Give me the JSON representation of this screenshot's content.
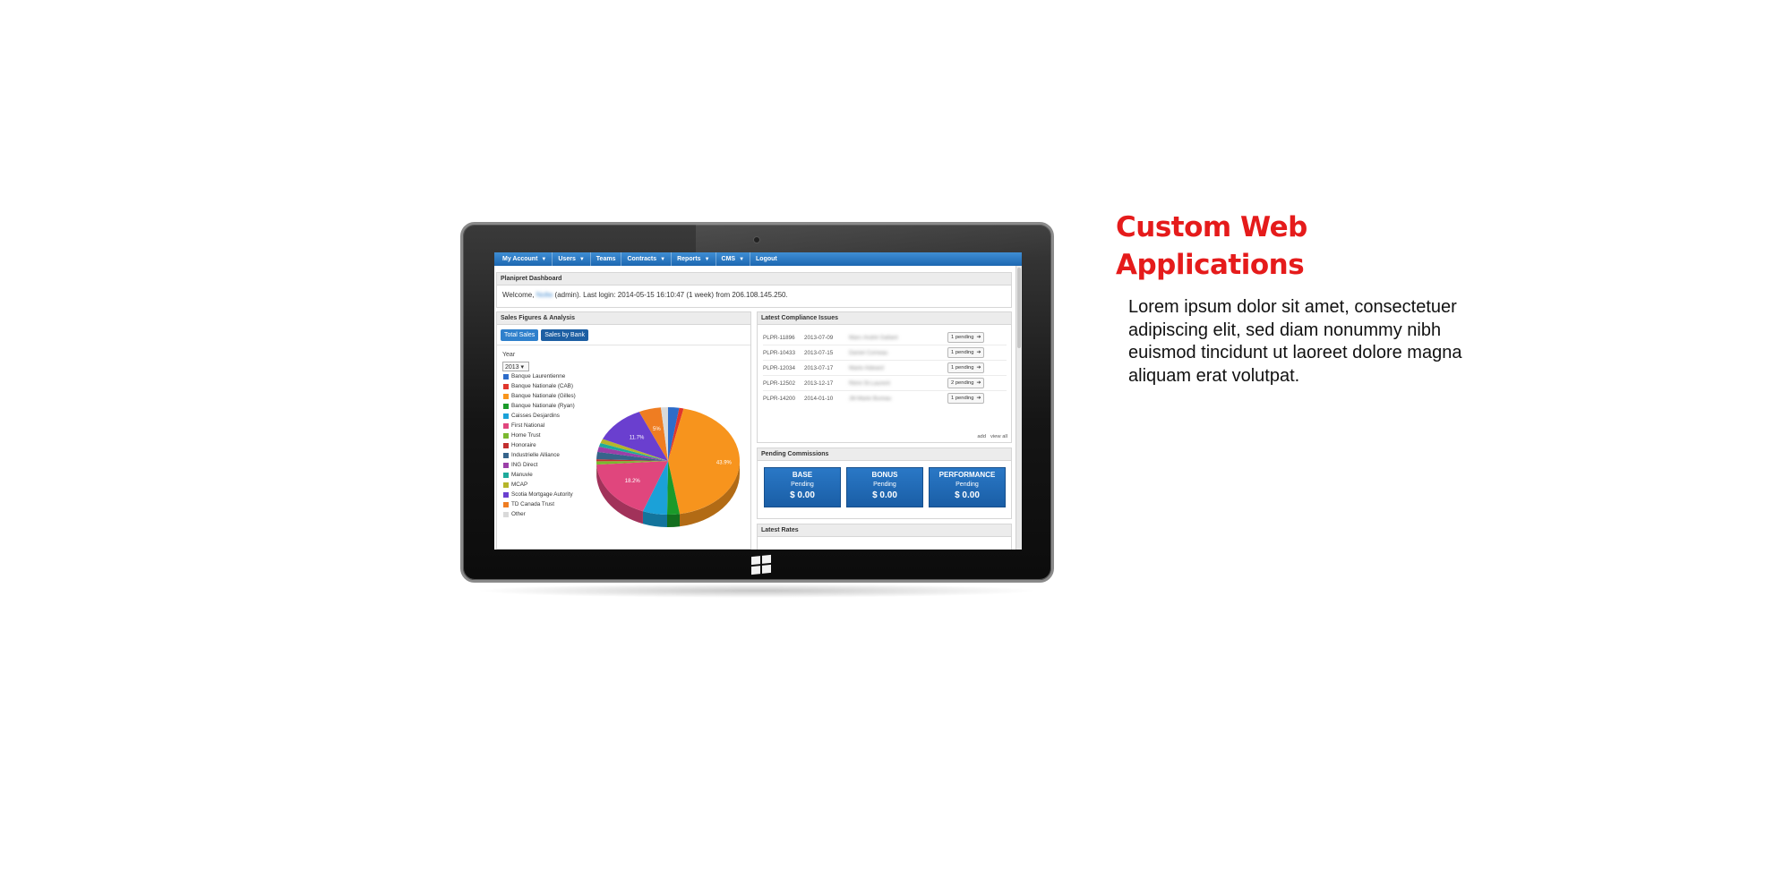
{
  "nav": {
    "items": [
      {
        "label": "My Account",
        "caret": true
      },
      {
        "label": "Users",
        "caret": true
      },
      {
        "label": "Teams",
        "caret": false
      },
      {
        "label": "Contracts",
        "caret": true
      },
      {
        "label": "Reports",
        "caret": true
      },
      {
        "label": "CMS",
        "caret": true
      },
      {
        "label": "Logout",
        "caret": false
      }
    ],
    "caret_glyph": "▼"
  },
  "dashboard": {
    "title": "Planipret Dashboard",
    "welcome_prefix": "Welcome, ",
    "user_name": "Nolte",
    "welcome_suffix": " (admin). Last login: 2014-05-15 16:10:47 (1 week) from 206.108.145.250."
  },
  "sales": {
    "title": "Sales Figures & Analysis",
    "tabs": [
      "Total Sales",
      "Sales by Bank"
    ],
    "year_label": "Year",
    "year_value": "2013 ▾",
    "legend": [
      {
        "label": "Banque Laurentienne",
        "color": "#2d6cc9"
      },
      {
        "label": "Banque Nationale (CAB)",
        "color": "#e0362c"
      },
      {
        "label": "Banque Nationale (Gilles)",
        "color": "#f7941d"
      },
      {
        "label": "Banque Nationale (Ryan)",
        "color": "#1a9a2a"
      },
      {
        "label": "Caisses Desjardins",
        "color": "#1ba1d8"
      },
      {
        "label": "First National",
        "color": "#e0467d"
      },
      {
        "label": "Home Trust",
        "color": "#7ab82f"
      },
      {
        "label": "Honoraire",
        "color": "#c22f2f"
      },
      {
        "label": "Industrielle Alliance",
        "color": "#36648b"
      },
      {
        "label": "ING Direct",
        "color": "#9b3fa8"
      },
      {
        "label": "Manuvie",
        "color": "#1eaa9b"
      },
      {
        "label": "MCAP",
        "color": "#b5b52a"
      },
      {
        "label": "Scotia Mortgage Autority",
        "color": "#6a3fcf"
      },
      {
        "label": "TD Canada Trust",
        "color": "#ef7d22"
      },
      {
        "label": "Other",
        "color": "#d9d9d9"
      }
    ]
  },
  "chart_data": {
    "type": "pie",
    "labels_shown": [
      "43.9%",
      "18.2%",
      "11.7%",
      "5%"
    ],
    "slices": [
      {
        "name": "Banque Laurentienne",
        "value": 2.5,
        "color": "#2d6cc9",
        "label": ""
      },
      {
        "name": "Banque Nationale (CAB)",
        "value": 1.0,
        "color": "#e0362c",
        "label": ""
      },
      {
        "name": "Banque Nationale (Gilles)",
        "value": 43.9,
        "color": "#f7941d",
        "label": "43.9%"
      },
      {
        "name": "Banque Nationale (Ryan)",
        "value": 2.8,
        "color": "#1a9a2a",
        "label": ""
      },
      {
        "name": "Caisses Desjardins",
        "value": 5.5,
        "color": "#1ba1d8",
        "label": ""
      },
      {
        "name": "First National",
        "value": 18.2,
        "color": "#e0467d",
        "label": "18.2%"
      },
      {
        "name": "Home Trust",
        "value": 1.0,
        "color": "#7ab82f",
        "label": ""
      },
      {
        "name": "Honoraire",
        "value": 0.6,
        "color": "#c22f2f",
        "label": ""
      },
      {
        "name": "Industrielle Alliance",
        "value": 2.2,
        "color": "#36648b",
        "label": ""
      },
      {
        "name": "ING Direct",
        "value": 1.6,
        "color": "#9b3fa8",
        "label": ""
      },
      {
        "name": "Manuvie",
        "value": 1.1,
        "color": "#1eaa9b",
        "label": ""
      },
      {
        "name": "MCAP",
        "value": 1.3,
        "color": "#b5b52a",
        "label": ""
      },
      {
        "name": "Scotia Mortgage Autority",
        "value": 11.7,
        "color": "#6a3fcf",
        "label": "11.7%"
      },
      {
        "name": "TD Canada Trust",
        "value": 5.0,
        "color": "#ef7d22",
        "label": "5%"
      },
      {
        "name": "Other",
        "value": 1.6,
        "color": "#d9d9d9",
        "label": ""
      }
    ]
  },
  "compliance": {
    "title": "Latest Compliance Issues",
    "rows": [
      {
        "id": "PLPR-11896",
        "date": "2013-07-09",
        "name": "Marc-André Gallant",
        "pending": "1 pending"
      },
      {
        "id": "PLPR-10433",
        "date": "2013-07-15",
        "name": "Daniel Comeau",
        "pending": "1 pending"
      },
      {
        "id": "PLPR-12034",
        "date": "2013-07-17",
        "name": "Marie Aldeard",
        "pending": "1 pending"
      },
      {
        "id": "PLPR-12502",
        "date": "2013-12-17",
        "name": "Rémi St-Laurent",
        "pending": "2 pending"
      },
      {
        "id": "PLPR-14200",
        "date": "2014-01-10",
        "name": "Jill-Marie Bureau",
        "pending": "1 pending"
      }
    ],
    "arrow_glyph": "➔",
    "add_link": "add",
    "view_all_link": "view all"
  },
  "commissions": {
    "title": "Pending Commissions",
    "boxes": [
      {
        "title": "BASE",
        "status": "Pending",
        "amount": "$ 0.00"
      },
      {
        "title": "BONUS",
        "status": "Pending",
        "amount": "$ 0.00"
      },
      {
        "title": "PERFORMANCE",
        "status": "Pending",
        "amount": "$ 0.00"
      }
    ]
  },
  "rates": {
    "title": "Latest Rates"
  },
  "copy": {
    "headline_line1": "Custom Web",
    "headline_line2": "Applications",
    "body": "Lorem ipsum dolor sit amet, consectetuer adipiscing elit, sed diam nonummy nibh euismod tincidunt ut laoreet dolore magna aliquam erat volutpat."
  },
  "colors": {
    "headline": "#e51b1b",
    "nav": "#1c67b1",
    "button": "#2a78c6"
  }
}
